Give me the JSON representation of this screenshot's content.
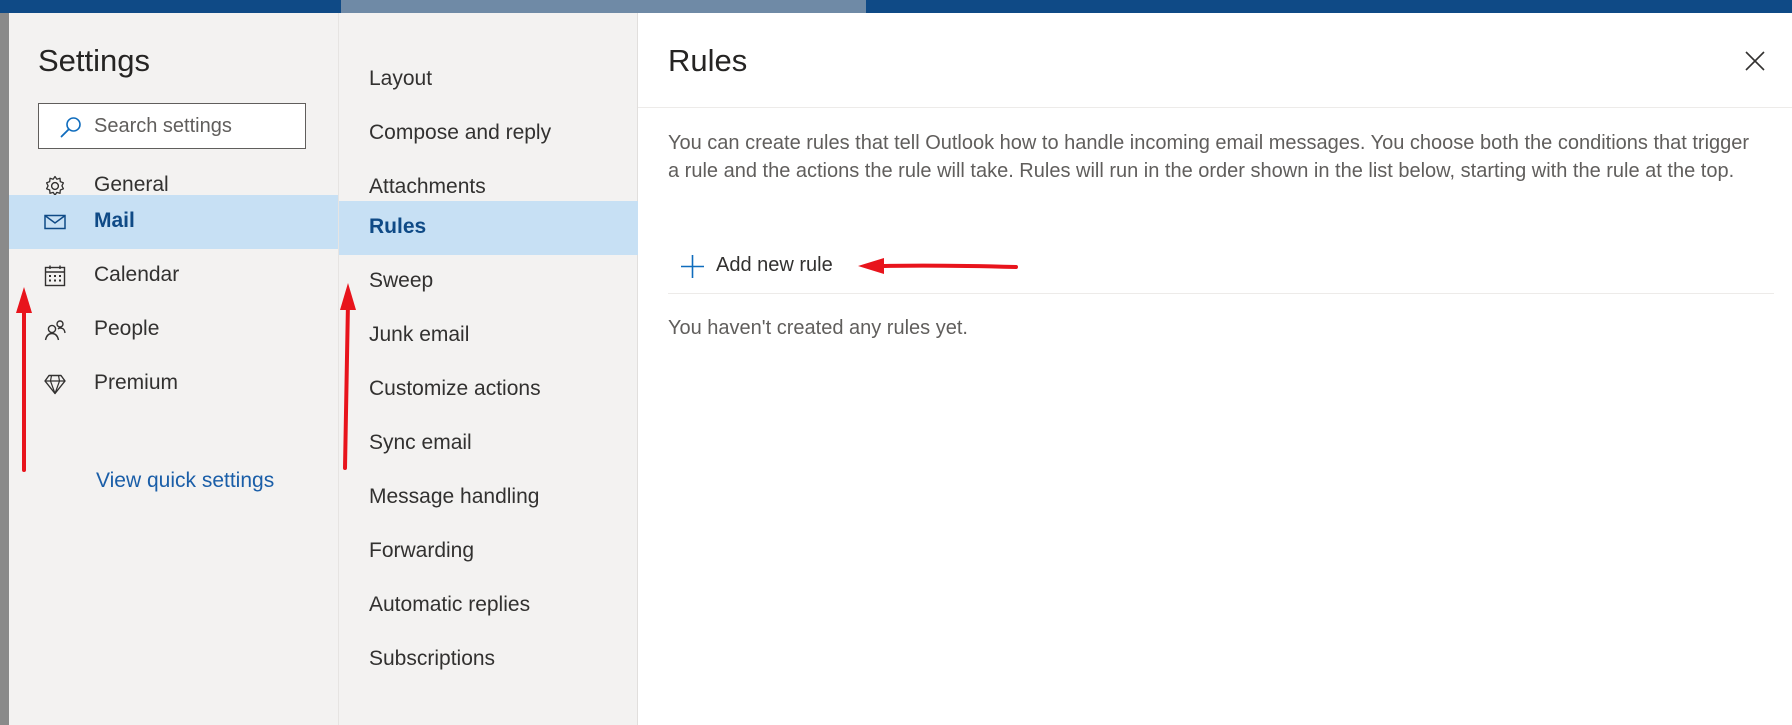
{
  "settings": {
    "title": "Settings",
    "search": {
      "placeholder": "Search settings"
    },
    "nav": [
      {
        "label": "General",
        "icon": "gear-icon",
        "selected": false
      },
      {
        "label": "Mail",
        "icon": "mail-icon",
        "selected": true
      },
      {
        "label": "Calendar",
        "icon": "calendar-icon",
        "selected": false
      },
      {
        "label": "People",
        "icon": "people-icon",
        "selected": false
      },
      {
        "label": "Premium",
        "icon": "diamond-icon",
        "selected": false
      }
    ],
    "quick_settings_link": "View quick settings"
  },
  "mail_subnav": [
    {
      "label": "Layout",
      "selected": false
    },
    {
      "label": "Compose and reply",
      "selected": false
    },
    {
      "label": "Attachments",
      "selected": false
    },
    {
      "label": "Rules",
      "selected": true
    },
    {
      "label": "Sweep",
      "selected": false
    },
    {
      "label": "Junk email",
      "selected": false
    },
    {
      "label": "Customize actions",
      "selected": false
    },
    {
      "label": "Sync email",
      "selected": false
    },
    {
      "label": "Message handling",
      "selected": false
    },
    {
      "label": "Forwarding",
      "selected": false
    },
    {
      "label": "Automatic replies",
      "selected": false
    },
    {
      "label": "Subscriptions",
      "selected": false
    }
  ],
  "rules_panel": {
    "title": "Rules",
    "description": "You can create rules that tell Outlook how to handle incoming email messages. You choose both the conditions that trigger a rule and the actions the rule will take. Rules will run in the order shown in the list below, starting with the rule at the top.",
    "add_rule_label": "Add new rule",
    "empty_message": "You haven't created any rules yet."
  },
  "colors": {
    "accent": "#0f6cbd",
    "selected_bg": "#c7e0f4",
    "annotation": "#e8141c",
    "topbar": "#0f4a86"
  }
}
